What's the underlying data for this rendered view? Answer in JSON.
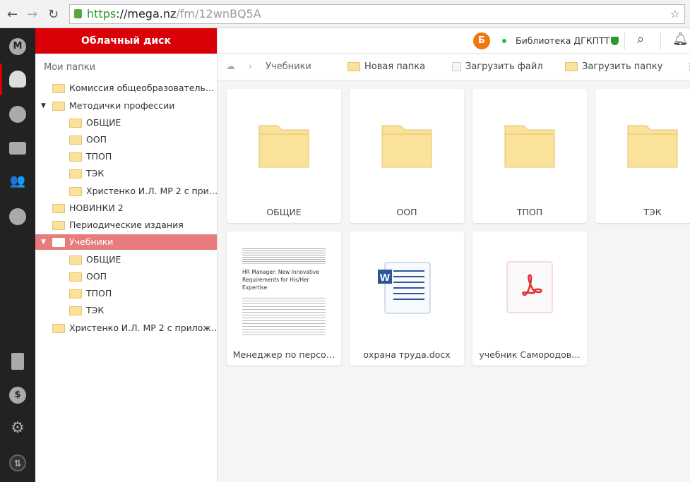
{
  "browser": {
    "url_scheme": "https",
    "url_host": "://mega.nz",
    "url_path": "/fm/12wnBQ5A"
  },
  "rail": {
    "items": [
      "mega-logo",
      "cloud-drive",
      "recents",
      "transfers",
      "contacts",
      "chat",
      "rubbish-bin",
      "account",
      "settings",
      "sync"
    ],
    "logo_letter": "M",
    "accent": "#d90007"
  },
  "tree": {
    "header": "Облачный диск",
    "title": "Мои папки",
    "items": [
      {
        "label": "Комиссия общеобразователь…",
        "level": 0
      },
      {
        "label": "Методички профессии",
        "level": 0,
        "expanded": true
      },
      {
        "label": "ОБЩИЕ",
        "level": 1
      },
      {
        "label": "ООП",
        "level": 1
      },
      {
        "label": "ТПОП",
        "level": 1
      },
      {
        "label": "ТЭК",
        "level": 1
      },
      {
        "label": "Христенко И.Л. МР 2 с при…",
        "level": 1
      },
      {
        "label": "НОВИНКИ 2",
        "level": 0
      },
      {
        "label": "Периодические издания",
        "level": 0
      },
      {
        "label": "Учебники",
        "level": 0,
        "expanded": true,
        "selected": true
      },
      {
        "label": "ОБЩИЕ",
        "level": 1
      },
      {
        "label": "ООП",
        "level": 1
      },
      {
        "label": "ТПОП",
        "level": 1
      },
      {
        "label": "ТЭК",
        "level": 1
      },
      {
        "label": "Христенко И.Л. МР 2 с прилож…",
        "level": 0
      }
    ]
  },
  "topbar": {
    "avatar_letter": "Б",
    "account_name": "Библиотека ДГКПТТ",
    "status": "online"
  },
  "toolbar": {
    "breadcrumb": "Учебники",
    "new_folder": "Новая папка",
    "upload_file": "Загрузить файл",
    "upload_folder": "Загрузить папку"
  },
  "files": [
    {
      "name": "ОБЩИЕ",
      "type": "folder"
    },
    {
      "name": "ООП",
      "type": "folder"
    },
    {
      "name": "ТПОП",
      "type": "folder"
    },
    {
      "name": "ТЭК",
      "type": "folder"
    },
    {
      "name": "Менеджер по персо…",
      "type": "document-thumbnail",
      "thumb_title": "HR Manager: New Innovative Requirements for His/Her Expertise"
    },
    {
      "name": "охрана труда.docx",
      "type": "word"
    },
    {
      "name": "учебник Самородов…",
      "type": "pdf"
    }
  ]
}
